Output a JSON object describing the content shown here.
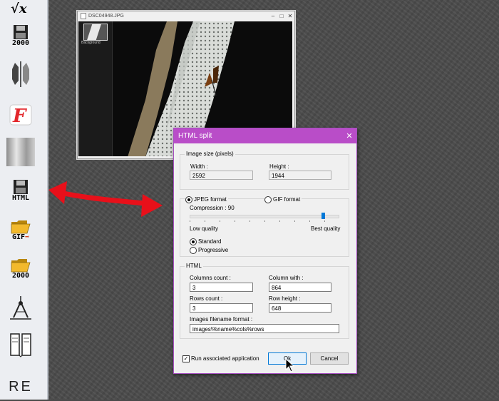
{
  "toolbar": {
    "items": [
      {
        "icon": "fx-icon",
        "caption": ""
      },
      {
        "icon": "floppy-disk-icon",
        "caption": "2000"
      },
      {
        "icon": "flip-icon",
        "caption": ""
      },
      {
        "icon": "font-icon",
        "caption": ""
      },
      {
        "icon": "gradient-icon",
        "caption": ""
      },
      {
        "icon": "floppy-disk-icon",
        "caption": "HTML"
      },
      {
        "icon": "open-folder-icon",
        "caption": "GIF"
      },
      {
        "icon": "open-folder-icon",
        "caption": "2000"
      },
      {
        "icon": "compass-icon",
        "caption": ""
      },
      {
        "icon": "book-icon",
        "caption": ""
      },
      {
        "icon": "text-icon",
        "caption": "RE"
      }
    ]
  },
  "image_window": {
    "title": "DSC04948.JPG",
    "layer_label": "Background"
  },
  "dialog": {
    "title": "HTML split",
    "image_size_label": "Image size (pixels)",
    "width_label": "Width :",
    "width_value": "2592",
    "height_label": "Height :",
    "height_value": "1944",
    "jpeg_label": "JPEG format",
    "gif_label": "GIF format",
    "compression_label": "Compression : 90",
    "compression_value": 90,
    "low_quality_label": "Low quality",
    "best_quality_label": "Best quality",
    "standard_label": "Standard",
    "progressive_label": "Progressive",
    "html_label": "HTML",
    "columns_count_label": "Columns count :",
    "columns_count_value": "3",
    "column_width_label": "Column with :",
    "column_width_value": "864",
    "rows_count_label": "Rows count :",
    "rows_count_value": "3",
    "row_height_label": "Row height :",
    "row_height_value": "648",
    "filename_format_label": "Images filename format :",
    "filename_format_value": "images\\%name%cols%rows",
    "run_app_label": "Run associated application",
    "ok_label": "Ok",
    "cancel_label": "Cancel"
  },
  "colors": {
    "dialog_title_bar": "#b94dc8",
    "annotation_arrow": "#e8101a",
    "workspace": "#4c4c4c"
  }
}
